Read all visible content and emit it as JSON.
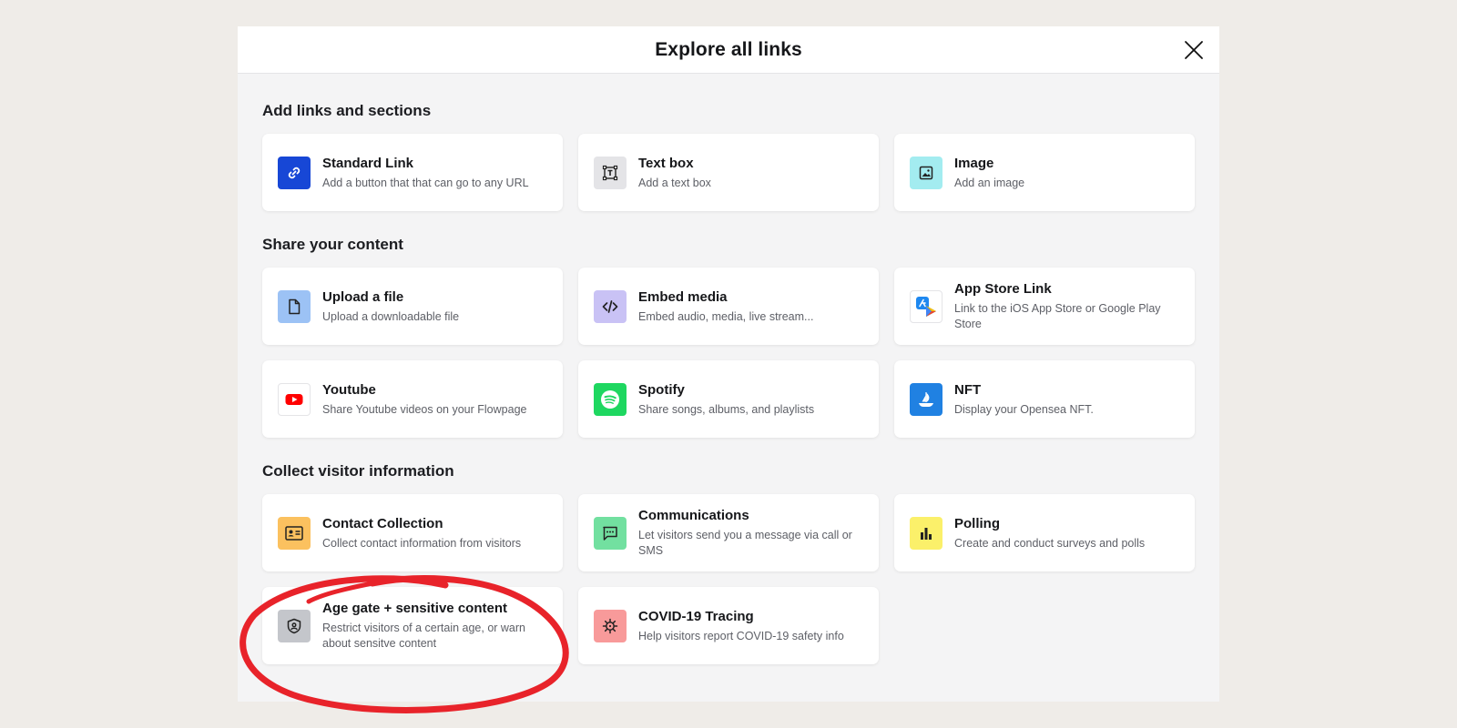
{
  "modal": {
    "title": "Explore all links"
  },
  "sections": {
    "add": {
      "title": "Add links and sections",
      "cards": {
        "standard_link": {
          "title": "Standard Link",
          "desc": "Add a button that that can go to any URL",
          "icon": "link-icon",
          "color": "#1747d6"
        },
        "text_box": {
          "title": "Text box",
          "desc": "Add a text box",
          "icon": "text-box-icon",
          "color": "#e4e4e7"
        },
        "image": {
          "title": "Image",
          "desc": "Add an image",
          "icon": "image-icon",
          "color": "#a3ecf0"
        }
      }
    },
    "share": {
      "title": "Share your content",
      "cards": {
        "upload": {
          "title": "Upload a file",
          "desc": "Upload a downloadable file",
          "icon": "file-icon",
          "color": "#9cc2f5"
        },
        "embed": {
          "title": "Embed media",
          "desc": "Embed audio, media, live stream...",
          "icon": "code-icon",
          "color": "#c9c2f5"
        },
        "app_store": {
          "title": "App Store Link",
          "desc": "Link to the iOS App Store or Google Play Store",
          "icon": "app-store-icon",
          "color": "#ffffff"
        },
        "youtube": {
          "title": "Youtube",
          "desc": "Share Youtube videos on your Flowpage",
          "icon": "youtube-icon",
          "color": "#ffffff"
        },
        "spotify": {
          "title": "Spotify",
          "desc": "Share songs, albums, and playlists",
          "icon": "spotify-icon",
          "color": "#1ed760"
        },
        "nft": {
          "title": "NFT",
          "desc": "Display your Opensea NFT.",
          "icon": "opensea-icon",
          "color": "#2081e2"
        }
      }
    },
    "collect": {
      "title": "Collect visitor information",
      "cards": {
        "contact": {
          "title": "Contact Collection",
          "desc": "Collect contact information from visitors",
          "icon": "contact-card-icon",
          "color": "#fbc15f"
        },
        "communications": {
          "title": "Communications",
          "desc": "Let visitors send you a message via call or SMS",
          "icon": "message-icon",
          "color": "#72e0a0"
        },
        "polling": {
          "title": "Polling",
          "desc": "Create and conduct surveys and polls",
          "icon": "bar-chart-icon",
          "color": "#fbf06a"
        },
        "age_gate": {
          "title": "Age gate + sensitive content",
          "desc": "Restrict visitors of a certain age, or warn about sensitve content",
          "icon": "shield-user-icon",
          "color": "#c4c6cb"
        },
        "covid": {
          "title": "COVID-19 Tracing",
          "desc": "Help visitors report COVID-19 safety info",
          "icon": "virus-icon",
          "color": "#f89a9a"
        }
      }
    }
  },
  "annotation": {
    "type": "hand-drawn circle",
    "color": "#e8232a",
    "target": "Age gate + sensitive content"
  }
}
